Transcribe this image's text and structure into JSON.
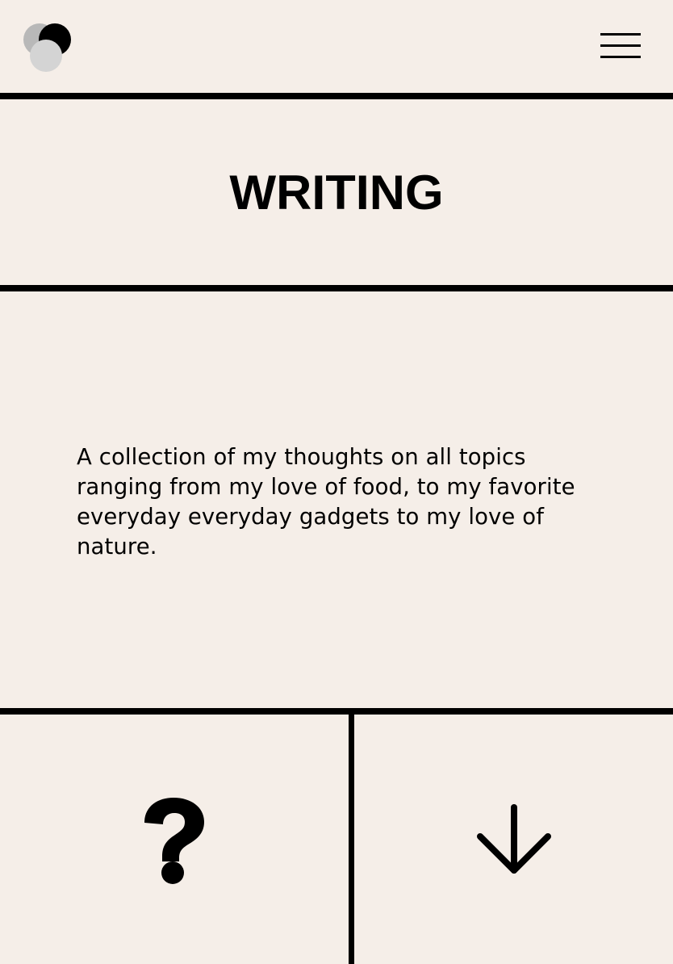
{
  "header": {
    "logo_icon": "overlapping-circles-logo",
    "menu_icon": "hamburger-menu-icon"
  },
  "page": {
    "title": "WRITING",
    "intro": "A collection of my thoughts on all topics ranging from my love of food, to my favorite everyday everyday gadgets to my love of nature."
  },
  "bottom": {
    "left_icon": "question-mark-icon",
    "right_icon": "arrow-down-icon"
  },
  "colors": {
    "background": "#f5eee8",
    "ink": "#000000",
    "logo_light": "#d4d4d4",
    "logo_mid": "#b8b8b8"
  }
}
